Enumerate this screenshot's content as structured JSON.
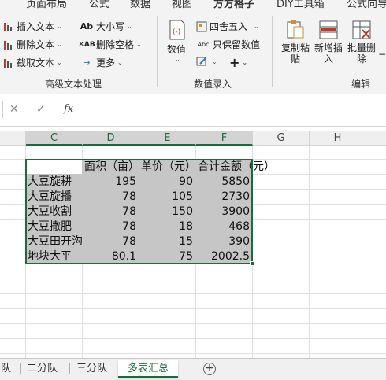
{
  "menu": {
    "tabs": [
      "页面布局",
      "公式",
      "数据",
      "视图",
      "方方格子",
      "DIY工具箱",
      "公式向导"
    ],
    "active": "方方格子"
  },
  "ribbon": {
    "text_group": {
      "label": "高级文本处理",
      "insert_text": "插入文本",
      "delete_text": "删除文本",
      "extract_text": "截取文本",
      "case": "大小写",
      "delete_space": "删除空格",
      "more": "更多"
    },
    "number_group": {
      "label": "数值录入",
      "number": "数值",
      "round": "四舍五入",
      "keep_value": "只保留数值"
    },
    "edit_group": {
      "label": "编辑",
      "copy_paste": "复制粘贴",
      "insert_new": "新增插入",
      "batch_delete": "批量删除"
    }
  },
  "formula_bar": {
    "cancel": "✕",
    "confirm": "✓",
    "fx": "fx",
    "content": ""
  },
  "columns": [
    "C",
    "D",
    "E",
    "F",
    "G",
    "H"
  ],
  "selected_columns": [
    "C",
    "D",
    "E",
    "F"
  ],
  "table": {
    "headers": [
      "",
      "面积（亩）",
      "单价（元）",
      "合计金额（元）"
    ],
    "rows": [
      [
        "大豆旋耕",
        "195",
        "90",
        "5850"
      ],
      [
        "大豆旋播",
        "78",
        "105",
        "2730"
      ],
      [
        "大豆收割",
        "78",
        "150",
        "3900"
      ],
      [
        "大豆撒肥",
        "78",
        "18",
        "468"
      ],
      [
        "大豆田开沟",
        "78",
        "15",
        "390"
      ],
      [
        "地块大平",
        "80.1",
        "75",
        "2002.5"
      ]
    ]
  },
  "sheet_tabs": [
    "一分队",
    "二分队",
    "三分队",
    "多表汇总"
  ],
  "active_sheet": "多表汇总",
  "colors": {
    "accent": "#1e6b3a",
    "selection": "#c6c6c6"
  }
}
